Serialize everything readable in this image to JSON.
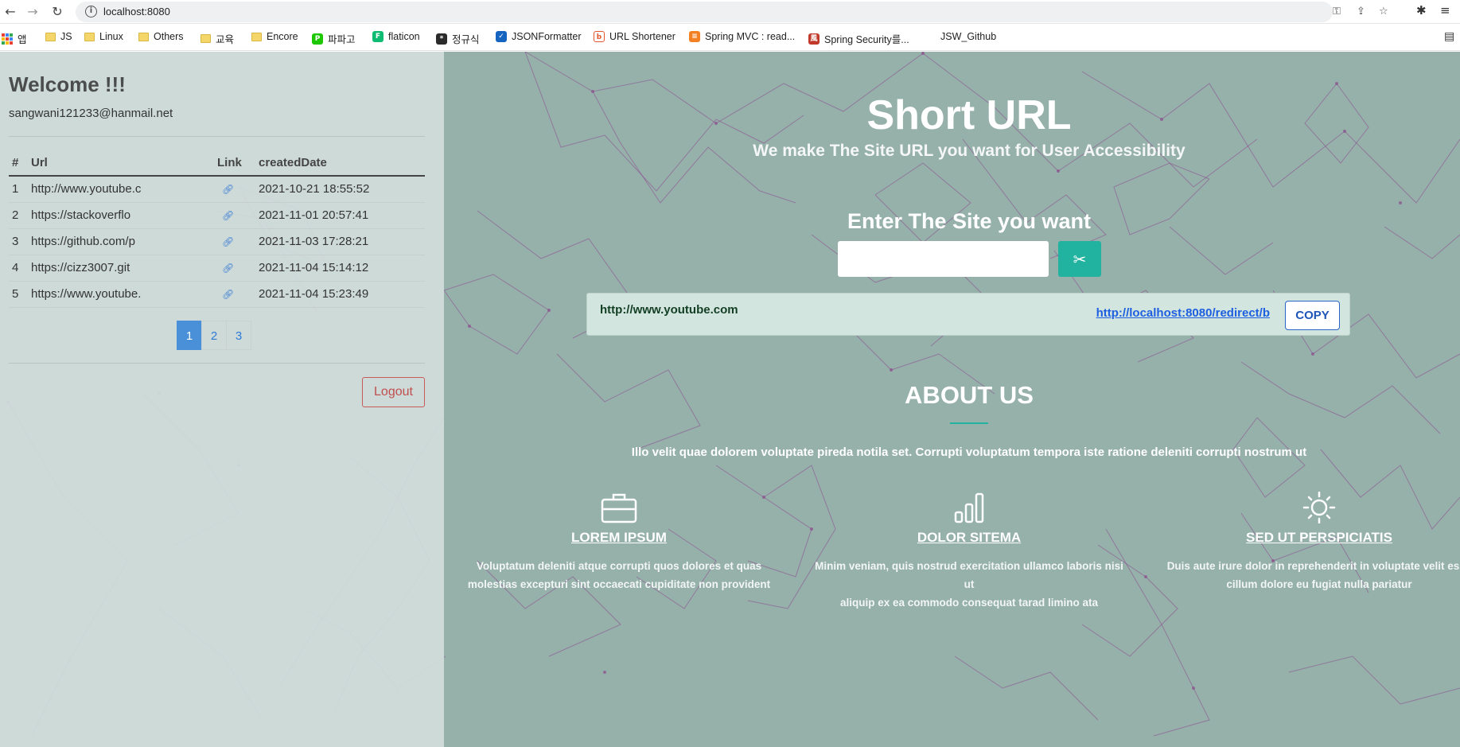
{
  "browser": {
    "url": "localhost:8080",
    "bookmarks": [
      {
        "label": "앱",
        "type": "apps"
      },
      {
        "label": "JS",
        "type": "folder"
      },
      {
        "label": "Linux",
        "type": "folder"
      },
      {
        "label": "Others",
        "type": "folder"
      },
      {
        "label": "교육",
        "type": "folder"
      },
      {
        "label": "Encore",
        "type": "folder"
      },
      {
        "label": "파파고",
        "type": "site"
      },
      {
        "label": "flaticon",
        "type": "site"
      },
      {
        "label": "정규식",
        "type": "site"
      },
      {
        "label": "JSONFormatter",
        "type": "site"
      },
      {
        "label": "URL Shortener",
        "type": "site"
      },
      {
        "label": "Spring MVC : read...",
        "type": "site"
      },
      {
        "label": "Spring Security를...",
        "type": "site"
      },
      {
        "label": "JSW_Github",
        "type": "site"
      }
    ]
  },
  "sidebar": {
    "welcome": "Welcome !!!",
    "email": "sangwani121233@hanmail.net",
    "table": {
      "headers": [
        "#",
        "Url",
        "Link",
        "createdDate"
      ],
      "rows": [
        {
          "num": "1",
          "url": "http://www.youtube.c",
          "created": "2021-10-21 18:55:52"
        },
        {
          "num": "2",
          "url": "https://stackoverflo",
          "created": "2021-11-01 20:57:41"
        },
        {
          "num": "3",
          "url": "https://github.com/p",
          "created": "2021-11-03 17:28:21"
        },
        {
          "num": "4",
          "url": "https://cizz3007.git",
          "created": "2021-11-04 15:14:12"
        },
        {
          "num": "5",
          "url": "https://www.youtube.",
          "created": "2021-11-04 15:23:49"
        }
      ]
    },
    "pages": [
      "1",
      "2",
      "3"
    ],
    "logout_label": "Logout"
  },
  "main": {
    "title": "Short URL",
    "subtitle": "We make The Site URL you want for User Accessibility",
    "enter_label": "Enter The Site you want",
    "input_value": "",
    "result": {
      "original": "http://www.youtube.com",
      "short": "http://localhost:8080/redirect/b",
      "copy_label": "COPY"
    },
    "about": {
      "title": "ABOUT US",
      "text": "Illo velit quae dolorem voluptate pireda notila set. Corrupti voluptatum tempora iste ratione deleniti corrupti nostrum ut"
    },
    "features": [
      {
        "icon": "briefcase-icon",
        "name": "LOREM IPSUM",
        "desc1": "Voluptatum deleniti atque corrupti quos dolores et quas",
        "desc2": "molestias excepturi sint occaecati cupiditate non provident"
      },
      {
        "icon": "bar-chart-icon",
        "name": "DOLOR SITEMA",
        "desc1": "Minim veniam, quis nostrud exercitation ullamco laboris nisi ut",
        "desc2": "aliquip ex ea commodo consequat tarad limino ata"
      },
      {
        "icon": "sun-icon",
        "name": "SED UT PERSPICIATIS",
        "desc1": "Duis aute irure dolor in reprehenderit in voluptate velit esse",
        "desc2": "cillum dolore eu fugiat nulla pariatur"
      }
    ]
  },
  "colors": {
    "page_bg": "#96b0aa",
    "sidebar_bg": "#d1dddb",
    "accent": "#21b2a0",
    "network_line": "#8a4d8f",
    "pager_active": "#4a90d9",
    "logout": "#c04f4f"
  }
}
